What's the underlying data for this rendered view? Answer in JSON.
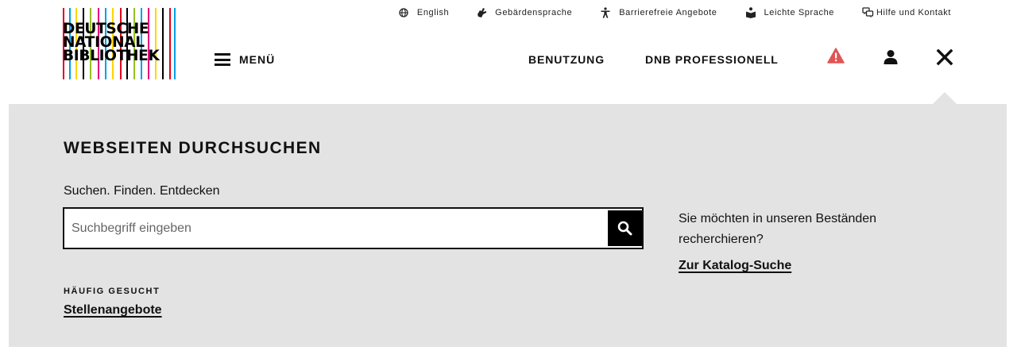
{
  "logo": {
    "lines": [
      "DEUTSCHE",
      "NATIONAL",
      "BIBLIOTHEK"
    ],
    "stripe_colors": [
      "#e2001a",
      "#009fe3",
      "#ffd500",
      "#000000",
      "#95c11f",
      "#e6007e"
    ]
  },
  "header": {
    "menu_label": "MENÜ",
    "utility_links": {
      "english": "English",
      "sign_language": "Gebärdensprache",
      "accessible": "Barrierefreie Angebote",
      "easy_language": "Leichte Sprache",
      "help_contact": "Hilfe und Kontakt"
    },
    "nav": {
      "usage": "BENUTZUNG",
      "professional": "DNB PROFESSIONELL"
    },
    "icons": {
      "warning": "warning-icon",
      "user": "user-icon",
      "close": "close-icon"
    },
    "colors": {
      "warning": "#e05555",
      "panel_bg": "#e3e3e3"
    }
  },
  "search_panel": {
    "title": "WEBSEITEN DURCHSUCHEN",
    "subtitle": "Suchen. Finden. Entdecken",
    "search_placeholder": "Suchbegriff eingeben",
    "search_value": "",
    "frequent_label": "HÄUFIG GESUCHT",
    "frequent_link": "Stellenangebote",
    "catalog_text": "Sie möchten in unseren Beständen recherchieren?",
    "catalog_link": "Zur Katalog-Suche"
  }
}
